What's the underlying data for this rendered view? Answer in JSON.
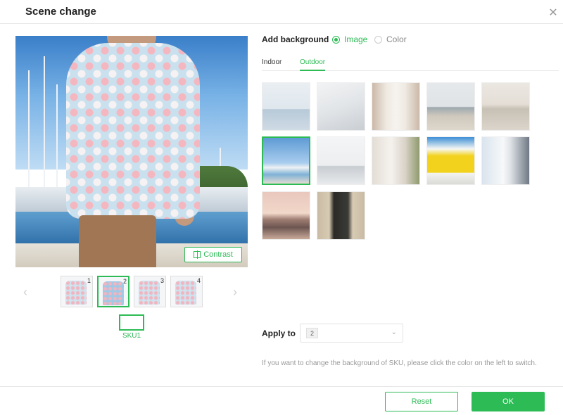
{
  "dialog": {
    "title": "Scene change",
    "close_icon": "close-icon"
  },
  "preview": {
    "contrast_label": "Contrast",
    "contrast_icon": "compare-icon"
  },
  "thumbnails": {
    "prev_icon": "chevron-left-icon",
    "next_icon": "chevron-right-icon",
    "items": [
      {
        "number": "1",
        "active": false
      },
      {
        "number": "2",
        "active": true
      },
      {
        "number": "3",
        "active": false
      },
      {
        "number": "4",
        "active": false
      }
    ]
  },
  "sku": {
    "label": "SKU1"
  },
  "background": {
    "label": "Add background",
    "options": [
      {
        "label": "Image",
        "checked": true
      },
      {
        "label": "Color",
        "checked": false
      }
    ],
    "tabs": [
      {
        "label": "Indoor",
        "active": false
      },
      {
        "label": "Outdoor",
        "active": true
      }
    ],
    "images": [
      {
        "name": "bg-pier-sea",
        "active": false
      },
      {
        "name": "bg-white-stairs",
        "active": false
      },
      {
        "name": "bg-arched-doorway",
        "active": false
      },
      {
        "name": "bg-beach",
        "active": false
      },
      {
        "name": "bg-boardwalk",
        "active": false
      },
      {
        "name": "bg-harbor-sailboats",
        "active": true
      },
      {
        "name": "bg-misty-pier",
        "active": false
      },
      {
        "name": "bg-courtyard-plants",
        "active": false
      },
      {
        "name": "bg-yellow-door",
        "active": false
      },
      {
        "name": "bg-white-door",
        "active": false
      },
      {
        "name": "bg-sunset-sea",
        "active": false
      },
      {
        "name": "bg-ornate-door",
        "active": false
      }
    ]
  },
  "apply": {
    "label": "Apply to",
    "selected": "2"
  },
  "hint": "If you want to change the background of SKU, please click the color on the left to switch.",
  "footer": {
    "reset_label": "Reset",
    "ok_label": "OK"
  },
  "colors": {
    "accent": "#2dbb55"
  }
}
